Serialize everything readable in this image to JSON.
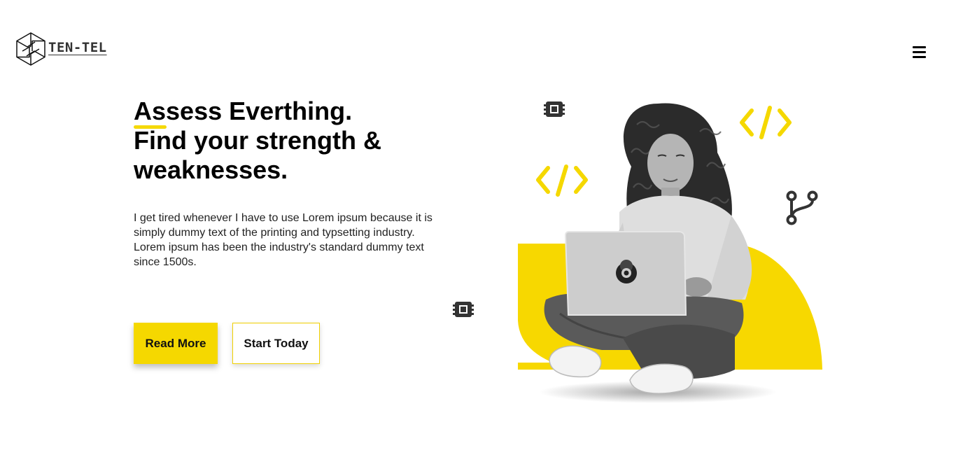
{
  "brand": {
    "name": "TEN-TEL"
  },
  "hero": {
    "headline_accent": "As",
    "headline_line1_rest": "sess Everthing.",
    "headline_line2": "Find your strength &",
    "headline_line3": "weaknesses.",
    "description": "I get tired whenever I have to use Lorem ipsum because it is simply dummy text of the printing and typsetting industry. Lorem ipsum has been the industry's standard dummy text since 1500s.",
    "primary_button": "Read More",
    "secondary_button": "Start Today"
  },
  "colors": {
    "accent": "#f5d800",
    "text": "#000000",
    "icon_dark": "#333333"
  },
  "icons": [
    "hexagon-logo-icon",
    "hamburger-menu-icon",
    "chip-icon",
    "code-brackets-icon",
    "git-branch-icon"
  ]
}
